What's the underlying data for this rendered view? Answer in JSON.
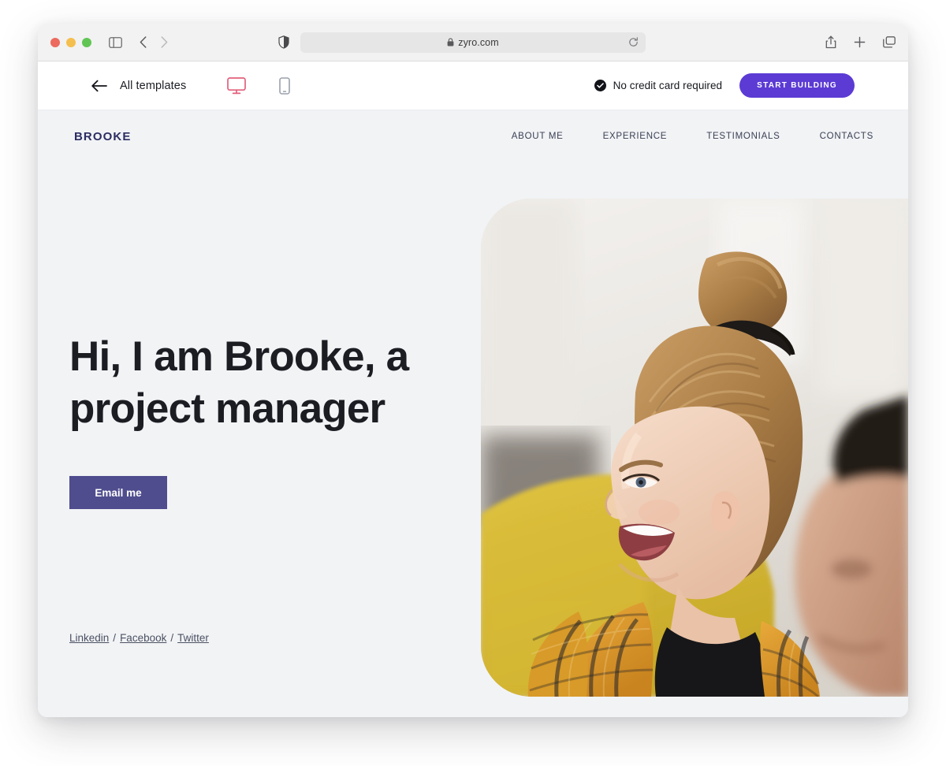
{
  "browser": {
    "traffic_lights": [
      "close",
      "minimize",
      "maximize"
    ],
    "url": "zyro.com",
    "lock_icon": "lock-icon",
    "reload_icon": "reload-icon",
    "sidebar_icon": "sidebar-toggle-icon",
    "back_icon": "chevron-left-icon",
    "forward_icon": "chevron-right-icon",
    "shield_icon": "privacy-shield-icon",
    "share_icon": "share-icon",
    "new_tab_icon": "plus-icon",
    "tabs_icon": "tab-overview-icon"
  },
  "app_toolbar": {
    "back_icon": "arrow-left-icon",
    "back_label": "All templates",
    "desktop_icon": "desktop-monitor-icon",
    "mobile_icon": "mobile-phone-icon",
    "no_credit_card": "No credit card required",
    "check_icon": "check-circle-icon",
    "cta_label": "START BUILDING",
    "accent_color": "#5b3bd4",
    "desktop_active_color": "#e2607b"
  },
  "site": {
    "logo": "BROOKE",
    "logo_color": "#2c2e63",
    "background_color": "#f2f3f5",
    "nav": [
      {
        "label": "ABOUT ME"
      },
      {
        "label": "EXPERIENCE"
      },
      {
        "label": "TESTIMONIALS"
      },
      {
        "label": "CONTACTS"
      }
    ],
    "hero": {
      "title": "Hi, I am Brooke, a project manager",
      "cta_label": "Email me",
      "cta_color": "#4f4d8e",
      "image_alt": "Smiling woman with hair bun in yellow plaid shirt sitting on yellow sofa",
      "social": [
        {
          "label": "Linkedin"
        },
        {
          "label": "Facebook"
        },
        {
          "label": "Twitter"
        }
      ],
      "social_separator": "/"
    }
  }
}
